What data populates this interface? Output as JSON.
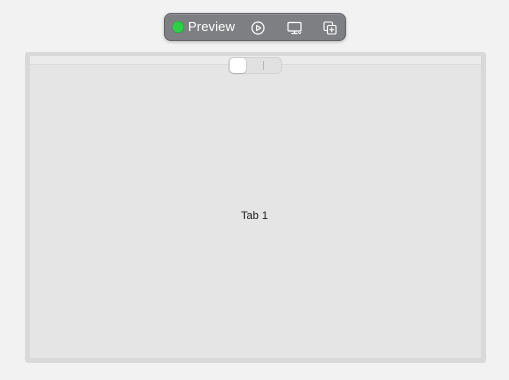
{
  "toolbar": {
    "status_icon": "green-status-dot-icon",
    "status_color": "#2ecf45",
    "preview_label": "Preview",
    "buttons": [
      {
        "name": "play-button",
        "icon": "play-circle-icon"
      },
      {
        "name": "device-settings-button",
        "icon": "monitor-icon"
      },
      {
        "name": "duplicate-button",
        "icon": "duplicate-icon"
      }
    ]
  },
  "tab_control": {
    "tabs": [
      "",
      ""
    ],
    "selected_index": 0
  },
  "content": {
    "label": "Tab 1"
  }
}
